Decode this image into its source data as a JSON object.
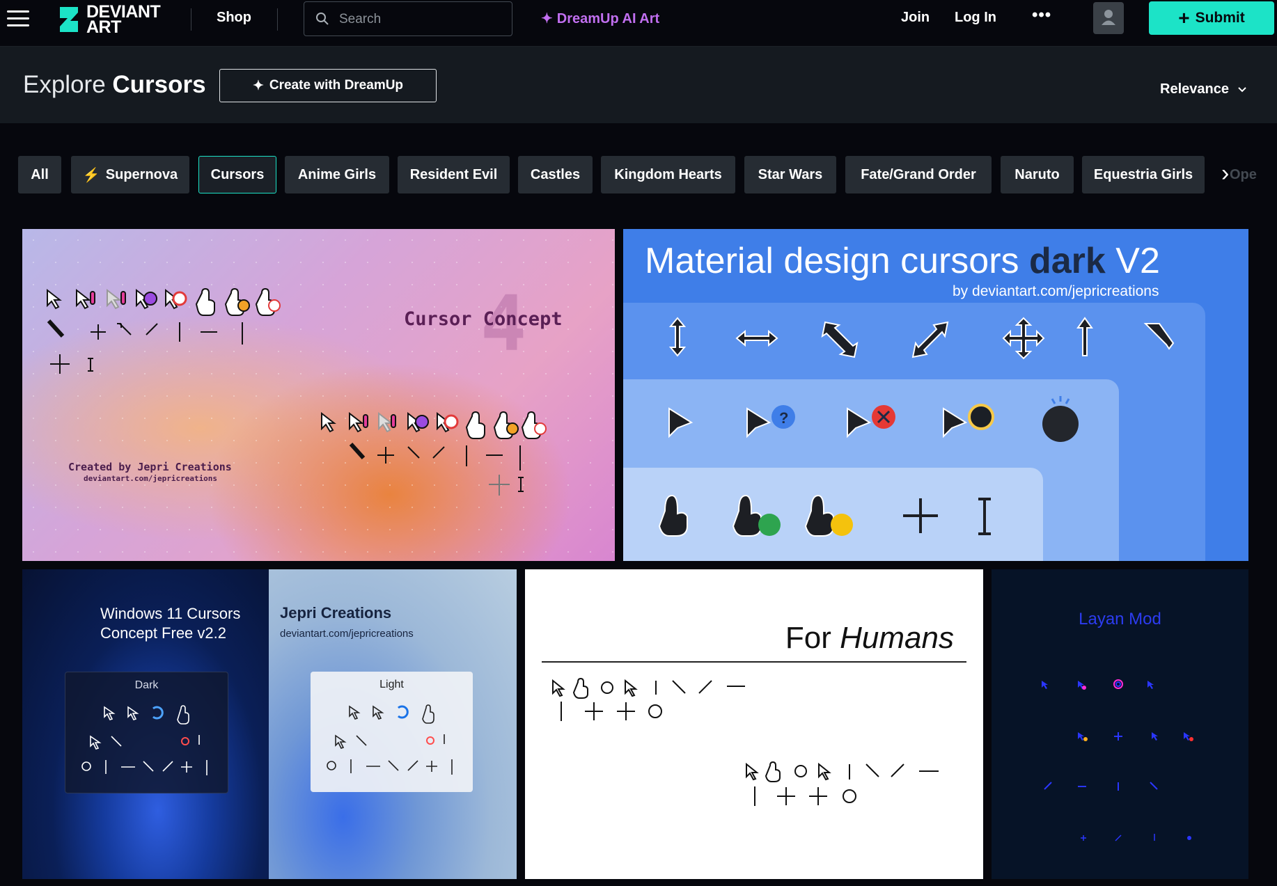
{
  "header": {
    "logo_text_line1": "DEVIANT",
    "logo_text_line2": "ART",
    "shop_label": "Shop",
    "search_placeholder": "Search",
    "dreamup_label": "DreamUp AI Art",
    "join_label": "Join",
    "login_label": "Log In",
    "more_label": "•••",
    "submit_label": "Submit"
  },
  "explore": {
    "title_prefix": "Explore",
    "title_topic": "Cursors",
    "create_label": "Create with DreamUp",
    "sort_label": "Relevance"
  },
  "chips": [
    {
      "label": "All"
    },
    {
      "label": "Supernova"
    },
    {
      "label": "Cursors"
    },
    {
      "label": "Anime Girls"
    },
    {
      "label": "Resident Evil"
    },
    {
      "label": "Castles"
    },
    {
      "label": "Kingdom Hearts"
    },
    {
      "label": "Star Wars"
    },
    {
      "label": "Fate/Grand Order"
    },
    {
      "label": "Naruto"
    },
    {
      "label": "Equestria Girls"
    }
  ],
  "chips_overflow_ghost": "Ope",
  "gallery": {
    "tile1": {
      "title": "Cursor Concept",
      "number": "4",
      "credit": "Created by Jepri Creations",
      "credit_url": "deviantart.com/jepricreations"
    },
    "tile2": {
      "title_light": "Material design cursors",
      "title_bold": "dark",
      "title_version": "V2",
      "byline": "by deviantart.com/jepricreations"
    },
    "tile3": {
      "title_line1": "Windows 11 Cursors",
      "title_line2": "Concept Free v2.2",
      "author": "Jepri Creations",
      "author_url": "deviantart.com/jepricreations",
      "dark_label": "Dark",
      "light_label": "Light"
    },
    "tile4": {
      "title_plain": "For",
      "title_italic": "Humans"
    },
    "tile5": {
      "title": "Layan Mod"
    }
  },
  "colors": {
    "accent": "#1ce3c7",
    "dreamup": "#c16ff0",
    "background": "#06070d"
  }
}
